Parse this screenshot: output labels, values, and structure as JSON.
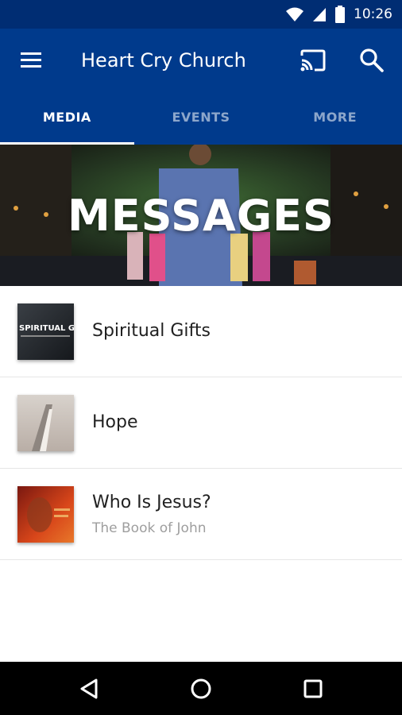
{
  "status_bar": {
    "time": "10:26",
    "icons": [
      "wifi-icon",
      "cell-signal-icon",
      "battery-icon"
    ]
  },
  "app_bar": {
    "title": "Heart Cry Church",
    "icons": [
      "menu-icon",
      "cast-icon",
      "search-icon"
    ]
  },
  "tabs": [
    {
      "label": "MEDIA",
      "active": true
    },
    {
      "label": "EVENTS",
      "active": false
    },
    {
      "label": "MORE",
      "active": false
    }
  ],
  "hero": {
    "title": "MESSAGES"
  },
  "messages": [
    {
      "title": "Spiritual Gifts",
      "subtitle": "",
      "thumb_text": "SPIRITUAL GIF"
    },
    {
      "title": "Hope",
      "subtitle": "",
      "thumb_text": ""
    },
    {
      "title": "Who Is Jesus?",
      "subtitle": "The Book of John",
      "thumb_text": ""
    }
  ],
  "nav_bar": {
    "icons": [
      "back-icon",
      "home-icon",
      "recents-icon"
    ]
  },
  "colors": {
    "primary": "#003a8c",
    "status_bar": "#002d73",
    "tab_inactive": "#8ea3c9"
  }
}
